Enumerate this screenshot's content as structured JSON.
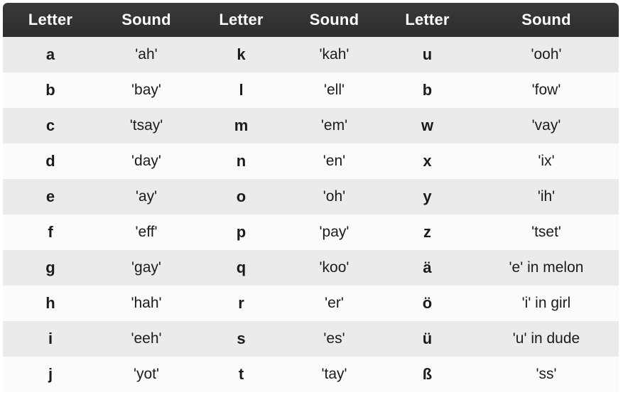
{
  "table": {
    "headers": [
      "Letter",
      "Sound",
      "Letter",
      "Sound",
      "Letter",
      "Sound"
    ],
    "rows": [
      {
        "c0": "a",
        "c1": "'ah'",
        "c2": "k",
        "c3": "'kah'",
        "c4": "u",
        "c5": "'ooh'"
      },
      {
        "c0": "b",
        "c1": "'bay'",
        "c2": "l",
        "c3": "'ell'",
        "c4": "b",
        "c5": "'fow'"
      },
      {
        "c0": "c",
        "c1": "'tsay'",
        "c2": "m",
        "c3": "'em'",
        "c4": "w",
        "c5": "'vay'"
      },
      {
        "c0": "d",
        "c1": "'day'",
        "c2": "n",
        "c3": "'en'",
        "c4": "x",
        "c5": "'ix'"
      },
      {
        "c0": "e",
        "c1": "'ay'",
        "c2": "o",
        "c3": "'oh'",
        "c4": "y",
        "c5": "'ih'"
      },
      {
        "c0": "f",
        "c1": "'eff'",
        "c2": "p",
        "c3": "'pay'",
        "c4": "z",
        "c5": "'tset'"
      },
      {
        "c0": "g",
        "c1": "'gay'",
        "c2": "q",
        "c3": "'koo'",
        "c4": "ä",
        "c5": "'e' in melon"
      },
      {
        "c0": "h",
        "c1": "'hah'",
        "c2": "r",
        "c3": "'er'",
        "c4": "ö",
        "c5": "'i' in girl"
      },
      {
        "c0": "i",
        "c1": "'eeh'",
        "c2": "s",
        "c3": "'es'",
        "c4": "ü",
        "c5": "'u' in dude"
      },
      {
        "c0": "j",
        "c1": "'yot'",
        "c2": "t",
        "c3": "'tay'",
        "c4": "ß",
        "c5": "'ss'"
      }
    ]
  },
  "colors": {
    "header_background": "#343434",
    "header_text": "#ffffff",
    "row_odd_background": "#ebebeb",
    "row_even_background": "#fbfbfb",
    "body_text": "#1b1b1b",
    "page_background": "#ffffff"
  }
}
